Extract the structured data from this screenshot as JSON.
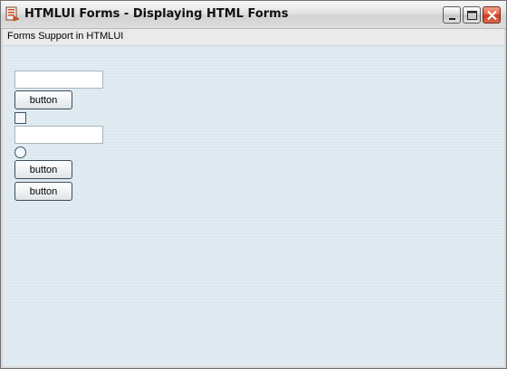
{
  "window": {
    "title": "HTMLUI Forms - Displaying HTML Forms",
    "app_icon": "app-document-icon",
    "controls": [
      "minimize-icon",
      "maximize-icon",
      "close-icon"
    ]
  },
  "page": {
    "title": "Forms Support in HTMLUI"
  },
  "form": {
    "text_field_1": {
      "value": ""
    },
    "button_1": {
      "label": "button"
    },
    "checkbox": {
      "checked": false
    },
    "text_field_2": {
      "value": ""
    },
    "radio": {
      "checked": false
    },
    "button_2": {
      "label": "button"
    },
    "button_3": {
      "label": "button"
    }
  },
  "colors": {
    "close_button": "#e0583a",
    "content_background": "#e1ebf1"
  }
}
